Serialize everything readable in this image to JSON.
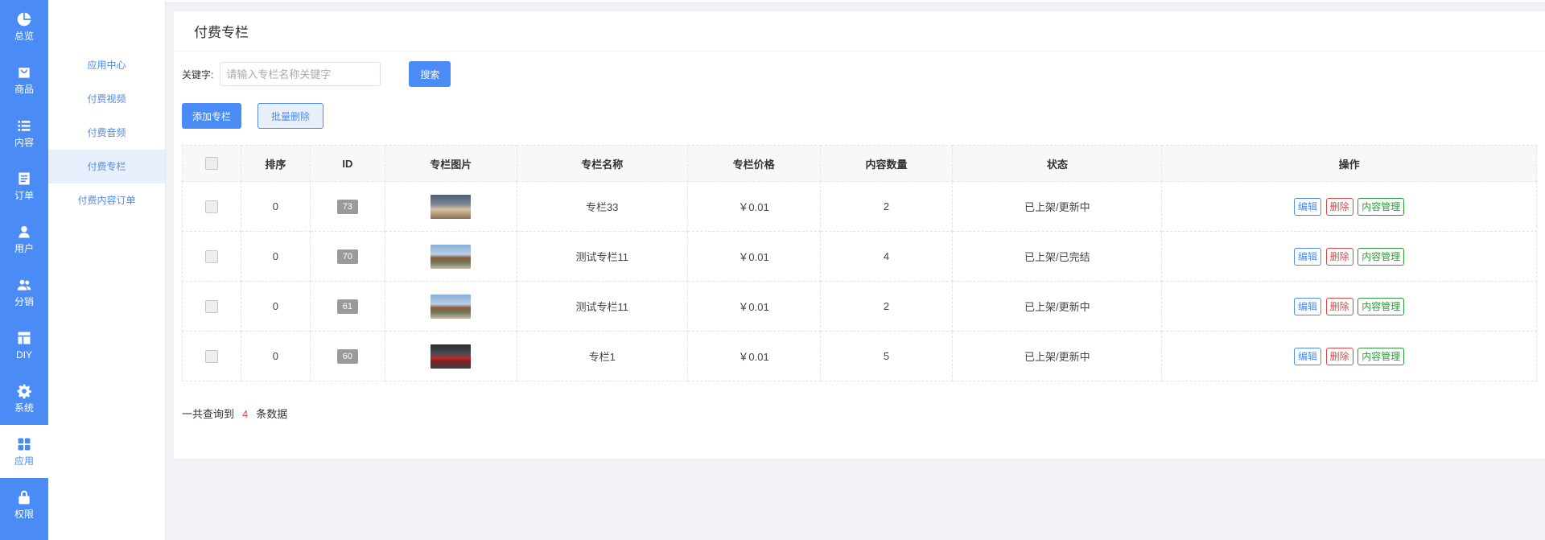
{
  "rail": {
    "items": [
      {
        "label": "总览",
        "icon": "pie-chart-icon"
      },
      {
        "label": "商品",
        "icon": "bag-icon"
      },
      {
        "label": "内容",
        "icon": "list-icon"
      },
      {
        "label": "订单",
        "icon": "document-icon"
      },
      {
        "label": "用户",
        "icon": "user-icon"
      },
      {
        "label": "分销",
        "icon": "users-icon"
      },
      {
        "label": "DIY",
        "icon": "layout-icon"
      },
      {
        "label": "系统",
        "icon": "gear-icon"
      },
      {
        "label": "应用",
        "icon": "grid-icon",
        "active": true
      },
      {
        "label": "权限",
        "icon": "lock-icon"
      }
    ]
  },
  "submenu": {
    "items": [
      {
        "label": "应用中心"
      },
      {
        "label": "付费视频"
      },
      {
        "label": "付费音频"
      },
      {
        "label": "付费专栏",
        "active": true
      },
      {
        "label": "付费内容订单"
      }
    ]
  },
  "page": {
    "title": "付费专栏"
  },
  "search": {
    "label": "关键字:",
    "placeholder": "请输入专栏名称关键字",
    "value": "",
    "button": "搜索"
  },
  "actions": {
    "add": "添加专栏",
    "batch_delete": "批量删除"
  },
  "table": {
    "headers": {
      "sort": "排序",
      "id": "ID",
      "image": "专栏图片",
      "name": "专栏名称",
      "price": "专栏价格",
      "count": "内容数量",
      "status": "状态",
      "ops": "操作"
    },
    "rows": [
      {
        "sort": "0",
        "id": "73",
        "image": "dog",
        "name": "专栏33",
        "price": "￥0.01",
        "count": "2",
        "status": "已上架/更新中"
      },
      {
        "sort": "0",
        "id": "70",
        "image": "clown",
        "name": "测试专栏11",
        "price": "￥0.01",
        "count": "4",
        "status": "已上架/已完结"
      },
      {
        "sort": "0",
        "id": "61",
        "image": "clown",
        "name": "测试专栏11",
        "price": "￥0.01",
        "count": "2",
        "status": "已上架/更新中"
      },
      {
        "sort": "0",
        "id": "60",
        "image": "car",
        "name": "专栏1",
        "price": "￥0.01",
        "count": "5",
        "status": "已上架/更新中"
      }
    ],
    "op_labels": {
      "edit": "编辑",
      "delete": "删除",
      "content": "内容管理"
    }
  },
  "footer": {
    "prefix": "一共查询到",
    "count": "4",
    "suffix": "条数据"
  },
  "colors": {
    "primary": "#4a8bf5",
    "danger": "#e04848",
    "success": "#2f9a3c"
  }
}
